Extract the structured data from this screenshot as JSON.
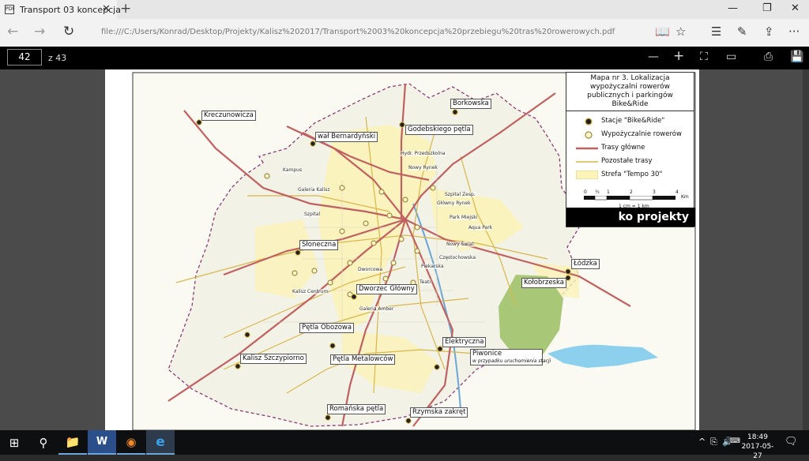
{
  "tab": {
    "title": "Transport 03 koncepcja",
    "pdf_glyph": "PDF",
    "close_glyph": "✕"
  },
  "newtab_glyph": "+",
  "window": {
    "minimize": "—",
    "restore": "❐",
    "close": "✕"
  },
  "address": {
    "url": "file:///C:/Users/Konrad/Desktop/Projekty/Kalisz%202017/Transport%2003%20koncepcja%20przebiegu%20tras%20rowerowych.pdf",
    "back": "←",
    "forward": "→",
    "refresh": "↻"
  },
  "toolbar_icons": {
    "reading": "📖",
    "favorite": "☆",
    "hub": "☰",
    "notes": "✎",
    "share": "⇪",
    "more": "···"
  },
  "pdf": {
    "page": "42",
    "total": "z 43",
    "zoom_out": "—",
    "zoom_in": "+",
    "fit": "⛶",
    "layout": "▭",
    "print": "⎙",
    "save": "💾"
  },
  "map": {
    "labels": [
      {
        "id": "kreczunowicza",
        "text": "Kreczunowicza"
      },
      {
        "id": "borkowska",
        "text": "Borkowska"
      },
      {
        "id": "bernardynski",
        "text": "wał Bernardyński"
      },
      {
        "id": "godebskiego",
        "text": "Godebskiego pętla"
      },
      {
        "id": "sloneczna",
        "text": "Słoneczna"
      },
      {
        "id": "lodzka",
        "text": "Łódzka"
      },
      {
        "id": "kolobrzeska",
        "text": "Kołobrzeska"
      },
      {
        "id": "dworzec",
        "text": "Dworzec Główny"
      },
      {
        "id": "obozowa",
        "text": "Pętla Obozowa"
      },
      {
        "id": "elektryczna",
        "text": "Elektryczna"
      },
      {
        "id": "piwonice",
        "text": "Piwonice"
      },
      {
        "id": "szczypiorno",
        "text": "Kalisz Szczypiorno"
      },
      {
        "id": "metalowcow",
        "text": "Pętla Metalowców"
      },
      {
        "id": "romanska",
        "text": "Romańska pętla"
      },
      {
        "id": "rzymska",
        "text": "Rzymska zakręt"
      }
    ],
    "piwonice_note": "w przypadku uruchomienia stacji",
    "small_labels": [
      "Kampus",
      "Galeria Kalisz",
      "Szpital",
      "Hydr. Przedszkolna",
      "Nowy Rynek",
      "Galeria Amber",
      "Szpital Zesp.",
      "Główny Rynek",
      "Park Miejski",
      "Aqua Park",
      "Nowy Świat",
      "Częstochowska",
      "Piekarska",
      "Teatr",
      "Dworcowa",
      "Kalisz Centrum"
    ]
  },
  "legend": {
    "title": "Mapa nr 3. Lokalizacja wypożyczalni rowerów publicznych i parkingów Bike&Ride",
    "items": [
      {
        "label": "Stacje \"Bike&Ride\"",
        "symbol": "station"
      },
      {
        "label": "Wypożyczalnie rowerów",
        "symbol": "rental"
      },
      {
        "label": "Trasy główne",
        "symbol": "main",
        "color": "#c06060"
      },
      {
        "label": "Pozostałe trasy",
        "symbol": "other",
        "color": "#d8b64a"
      },
      {
        "label": "Strefa \"Tempo 30\"",
        "symbol": "zone",
        "color": "#fbf3b8"
      }
    ],
    "scale_ticks": [
      "0",
      "½",
      "1",
      "2",
      "3",
      "4"
    ],
    "scale_unit": "Km",
    "scale_note": "1 cm = 1 km",
    "brand": "ko projekty"
  },
  "taskbar": {
    "start": "⊞",
    "search": "⚲",
    "explorer": "📁",
    "word": "W",
    "firefox": "◉",
    "edge": "e",
    "tray_chevron": "^",
    "network": "⎘",
    "volume": "🔊",
    "keyboard": "⌨",
    "time": "18:49",
    "date": "2017-05-27",
    "notifications": "🗨"
  }
}
